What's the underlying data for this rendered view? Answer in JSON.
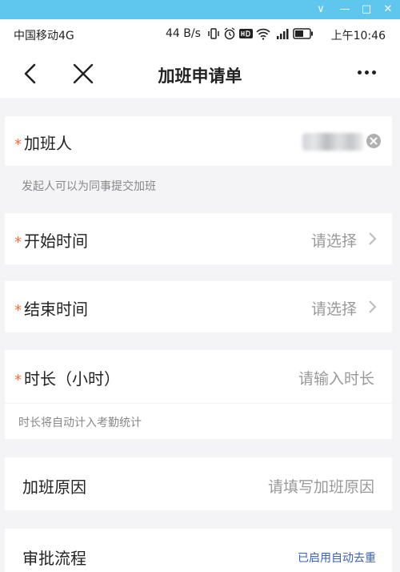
{
  "window": {
    "buttons": {
      "minimize": "∨",
      "restore": "—",
      "maximize": "□",
      "close": "✕"
    }
  },
  "status_bar": {
    "carrier": "中国移动4G",
    "speed": "44 B/s",
    "time": "上午10:46"
  },
  "nav": {
    "title": "加班申请单"
  },
  "form": {
    "applicant": {
      "label": "加班人",
      "hint": "发起人可以为同事提交加班"
    },
    "start_time": {
      "label": "开始时间",
      "placeholder": "请选择"
    },
    "end_time": {
      "label": "结束时间",
      "placeholder": "请选择"
    },
    "duration": {
      "label": "时长（小时）",
      "placeholder": "请输入时长",
      "hint": "时长将自动计入考勤统计"
    },
    "reason": {
      "label": "加班原因",
      "placeholder": "请填写加班原因"
    },
    "approval": {
      "label": "审批流程",
      "link": "已启用自动去重"
    }
  },
  "required_mark": "*",
  "colors": {
    "titlebar": "#5fc7ee",
    "required": "#f0704a",
    "link": "#3a62b5",
    "placeholder": "#999999"
  }
}
